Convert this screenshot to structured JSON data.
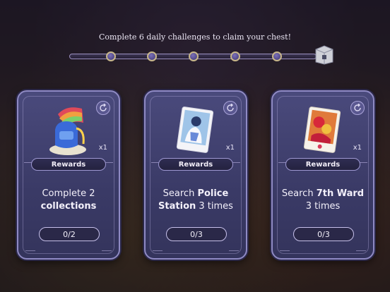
{
  "header": {
    "text": "Complete 6 daily challenges to claim your chest!"
  },
  "track": {
    "milestones_completed": 0,
    "milestones_total": 5,
    "reward_icon": "chest-icon"
  },
  "cards": [
    {
      "reward_icon": "rainbow-backpack-icon",
      "quantity": "x1",
      "rewards_label": "Rewards",
      "task_prefix": "Complete 2",
      "task_highlight": "collections",
      "task_suffix": "",
      "progress": "0/2",
      "progress_value": 0,
      "progress_total": 2
    },
    {
      "reward_icon": "character-card-icon",
      "quantity": "x1",
      "rewards_label": "Rewards",
      "task_prefix": "Search ",
      "task_highlight": "Police Station",
      "task_suffix": " 3 times",
      "progress": "0/3",
      "progress_value": 0,
      "progress_total": 3
    },
    {
      "reward_icon": "flowers-card-icon",
      "quantity": "x1",
      "rewards_label": "Rewards",
      "task_prefix": "Search ",
      "task_highlight": "7th Ward",
      "task_suffix": " 3 times",
      "progress": "0/3",
      "progress_value": 0,
      "progress_total": 3
    }
  ],
  "colors": {
    "card_bg": "#3f3f70",
    "card_border": "#8f8ac4",
    "node_gold": "#c8b78a"
  }
}
